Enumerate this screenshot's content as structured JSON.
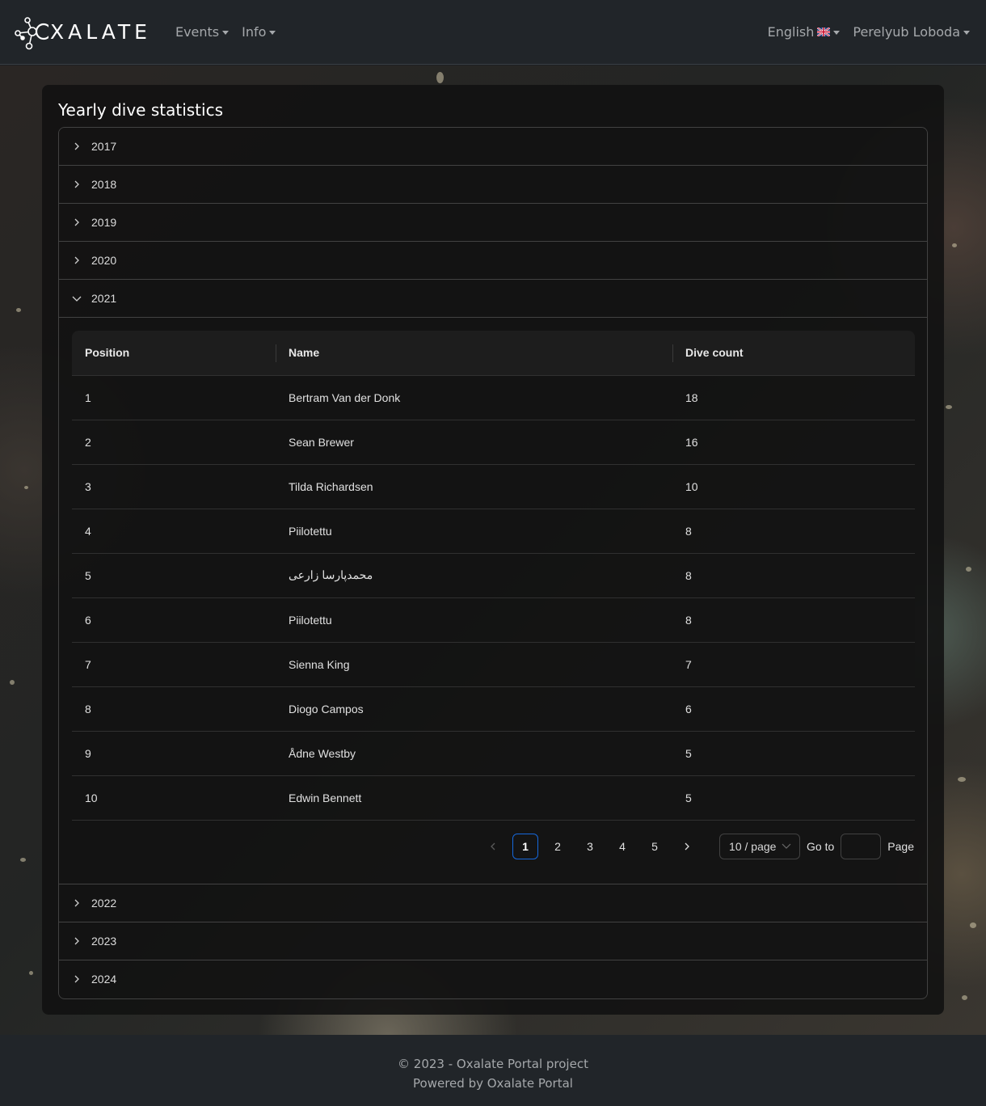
{
  "navbar": {
    "brand": "XALATE",
    "menu": [
      {
        "label": "Events"
      },
      {
        "label": "Info"
      }
    ],
    "language": "English",
    "user": "Perelyub Loboda"
  },
  "card": {
    "title": "Yearly dive statistics"
  },
  "accordion": {
    "years_before": [
      "2017",
      "2018",
      "2019",
      "2020"
    ],
    "expanded_year": "2021",
    "years_after": [
      "2022",
      "2023",
      "2024"
    ]
  },
  "table": {
    "columns": [
      "Position",
      "Name",
      "Dive count"
    ],
    "rows": [
      [
        "1",
        "Bertram Van der Donk",
        "18"
      ],
      [
        "2",
        "Sean Brewer",
        "16"
      ],
      [
        "3",
        "Tilda Richardsen",
        "10"
      ],
      [
        "4",
        "Piilotettu",
        "8"
      ],
      [
        "5",
        "محمدپارسا زارعی",
        "8"
      ],
      [
        "6",
        "Piilotettu",
        "8"
      ],
      [
        "7",
        "Sienna King",
        "7"
      ],
      [
        "8",
        "Diogo Campos",
        "6"
      ],
      [
        "9",
        "Ådne Westby",
        "5"
      ],
      [
        "10",
        "Edwin Bennett",
        "5"
      ]
    ]
  },
  "pagination": {
    "pages": [
      "1",
      "2",
      "3",
      "4",
      "5"
    ],
    "current": "1",
    "page_size": "10 / page",
    "goto_label": "Go to",
    "page_label": "Page"
  },
  "footer": {
    "copyright": "© 2023 - Oxalate Portal project",
    "powered": "Powered by Oxalate Portal"
  },
  "colors": {
    "navbar_bg": "#212529",
    "active_page": "#1668dc"
  }
}
